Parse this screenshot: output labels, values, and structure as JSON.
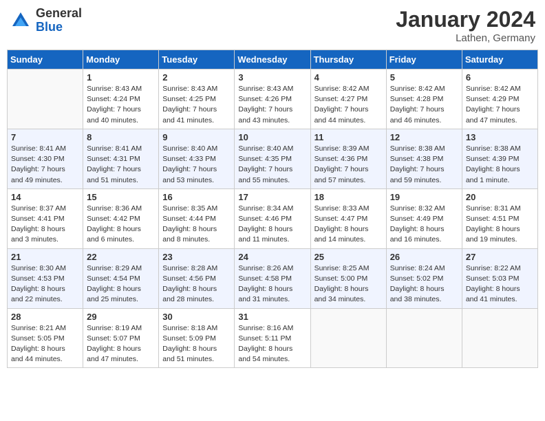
{
  "header": {
    "logo_general": "General",
    "logo_blue": "Blue",
    "month_title": "January 2024",
    "location": "Lathen, Germany"
  },
  "columns": [
    "Sunday",
    "Monday",
    "Tuesday",
    "Wednesday",
    "Thursday",
    "Friday",
    "Saturday"
  ],
  "weeks": [
    [
      {
        "day": "",
        "sunrise": "",
        "sunset": "",
        "daylight": ""
      },
      {
        "day": "1",
        "sunrise": "Sunrise: 8:43 AM",
        "sunset": "Sunset: 4:24 PM",
        "daylight": "Daylight: 7 hours and 40 minutes."
      },
      {
        "day": "2",
        "sunrise": "Sunrise: 8:43 AM",
        "sunset": "Sunset: 4:25 PM",
        "daylight": "Daylight: 7 hours and 41 minutes."
      },
      {
        "day": "3",
        "sunrise": "Sunrise: 8:43 AM",
        "sunset": "Sunset: 4:26 PM",
        "daylight": "Daylight: 7 hours and 43 minutes."
      },
      {
        "day": "4",
        "sunrise": "Sunrise: 8:42 AM",
        "sunset": "Sunset: 4:27 PM",
        "daylight": "Daylight: 7 hours and 44 minutes."
      },
      {
        "day": "5",
        "sunrise": "Sunrise: 8:42 AM",
        "sunset": "Sunset: 4:28 PM",
        "daylight": "Daylight: 7 hours and 46 minutes."
      },
      {
        "day": "6",
        "sunrise": "Sunrise: 8:42 AM",
        "sunset": "Sunset: 4:29 PM",
        "daylight": "Daylight: 7 hours and 47 minutes."
      }
    ],
    [
      {
        "day": "7",
        "sunrise": "Sunrise: 8:41 AM",
        "sunset": "Sunset: 4:30 PM",
        "daylight": "Daylight: 7 hours and 49 minutes."
      },
      {
        "day": "8",
        "sunrise": "Sunrise: 8:41 AM",
        "sunset": "Sunset: 4:31 PM",
        "daylight": "Daylight: 7 hours and 51 minutes."
      },
      {
        "day": "9",
        "sunrise": "Sunrise: 8:40 AM",
        "sunset": "Sunset: 4:33 PM",
        "daylight": "Daylight: 7 hours and 53 minutes."
      },
      {
        "day": "10",
        "sunrise": "Sunrise: 8:40 AM",
        "sunset": "Sunset: 4:35 PM",
        "daylight": "Daylight: 7 hours and 55 minutes."
      },
      {
        "day": "11",
        "sunrise": "Sunrise: 8:39 AM",
        "sunset": "Sunset: 4:36 PM",
        "daylight": "Daylight: 7 hours and 57 minutes."
      },
      {
        "day": "12",
        "sunrise": "Sunrise: 8:38 AM",
        "sunset": "Sunset: 4:38 PM",
        "daylight": "Daylight: 7 hours and 59 minutes."
      },
      {
        "day": "13",
        "sunrise": "Sunrise: 8:38 AM",
        "sunset": "Sunset: 4:39 PM",
        "daylight": "Daylight: 8 hours and 1 minute."
      }
    ],
    [
      {
        "day": "14",
        "sunrise": "Sunrise: 8:37 AM",
        "sunset": "Sunset: 4:41 PM",
        "daylight": "Daylight: 8 hours and 3 minutes."
      },
      {
        "day": "15",
        "sunrise": "Sunrise: 8:36 AM",
        "sunset": "Sunset: 4:42 PM",
        "daylight": "Daylight: 8 hours and 6 minutes."
      },
      {
        "day": "16",
        "sunrise": "Sunrise: 8:35 AM",
        "sunset": "Sunset: 4:44 PM",
        "daylight": "Daylight: 8 hours and 8 minutes."
      },
      {
        "day": "17",
        "sunrise": "Sunrise: 8:34 AM",
        "sunset": "Sunset: 4:46 PM",
        "daylight": "Daylight: 8 hours and 11 minutes."
      },
      {
        "day": "18",
        "sunrise": "Sunrise: 8:33 AM",
        "sunset": "Sunset: 4:47 PM",
        "daylight": "Daylight: 8 hours and 14 minutes."
      },
      {
        "day": "19",
        "sunrise": "Sunrise: 8:32 AM",
        "sunset": "Sunset: 4:49 PM",
        "daylight": "Daylight: 8 hours and 16 minutes."
      },
      {
        "day": "20",
        "sunrise": "Sunrise: 8:31 AM",
        "sunset": "Sunset: 4:51 PM",
        "daylight": "Daylight: 8 hours and 19 minutes."
      }
    ],
    [
      {
        "day": "21",
        "sunrise": "Sunrise: 8:30 AM",
        "sunset": "Sunset: 4:53 PM",
        "daylight": "Daylight: 8 hours and 22 minutes."
      },
      {
        "day": "22",
        "sunrise": "Sunrise: 8:29 AM",
        "sunset": "Sunset: 4:54 PM",
        "daylight": "Daylight: 8 hours and 25 minutes."
      },
      {
        "day": "23",
        "sunrise": "Sunrise: 8:28 AM",
        "sunset": "Sunset: 4:56 PM",
        "daylight": "Daylight: 8 hours and 28 minutes."
      },
      {
        "day": "24",
        "sunrise": "Sunrise: 8:26 AM",
        "sunset": "Sunset: 4:58 PM",
        "daylight": "Daylight: 8 hours and 31 minutes."
      },
      {
        "day": "25",
        "sunrise": "Sunrise: 8:25 AM",
        "sunset": "Sunset: 5:00 PM",
        "daylight": "Daylight: 8 hours and 34 minutes."
      },
      {
        "day": "26",
        "sunrise": "Sunrise: 8:24 AM",
        "sunset": "Sunset: 5:02 PM",
        "daylight": "Daylight: 8 hours and 38 minutes."
      },
      {
        "day": "27",
        "sunrise": "Sunrise: 8:22 AM",
        "sunset": "Sunset: 5:03 PM",
        "daylight": "Daylight: 8 hours and 41 minutes."
      }
    ],
    [
      {
        "day": "28",
        "sunrise": "Sunrise: 8:21 AM",
        "sunset": "Sunset: 5:05 PM",
        "daylight": "Daylight: 8 hours and 44 minutes."
      },
      {
        "day": "29",
        "sunrise": "Sunrise: 8:19 AM",
        "sunset": "Sunset: 5:07 PM",
        "daylight": "Daylight: 8 hours and 47 minutes."
      },
      {
        "day": "30",
        "sunrise": "Sunrise: 8:18 AM",
        "sunset": "Sunset: 5:09 PM",
        "daylight": "Daylight: 8 hours and 51 minutes."
      },
      {
        "day": "31",
        "sunrise": "Sunrise: 8:16 AM",
        "sunset": "Sunset: 5:11 PM",
        "daylight": "Daylight: 8 hours and 54 minutes."
      },
      {
        "day": "",
        "sunrise": "",
        "sunset": "",
        "daylight": ""
      },
      {
        "day": "",
        "sunrise": "",
        "sunset": "",
        "daylight": ""
      },
      {
        "day": "",
        "sunrise": "",
        "sunset": "",
        "daylight": ""
      }
    ]
  ]
}
